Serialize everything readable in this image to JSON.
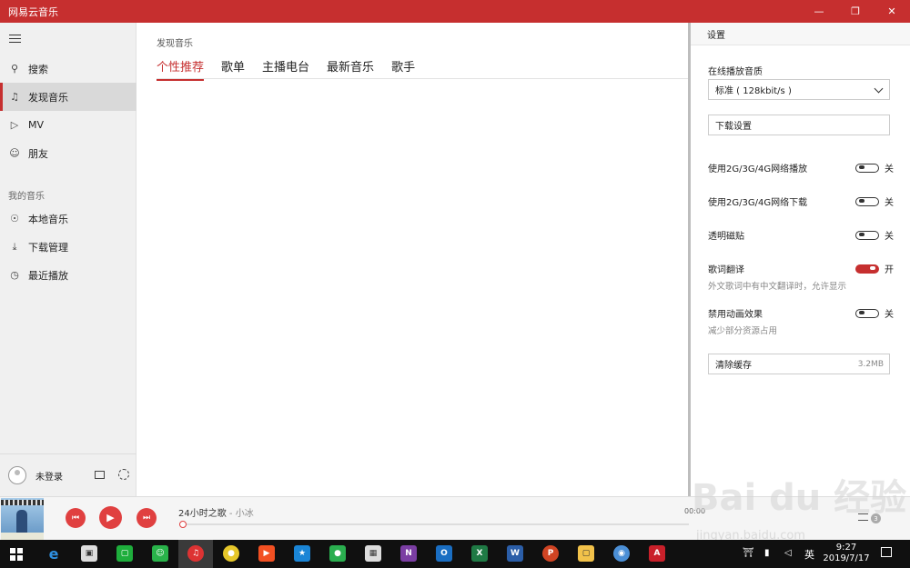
{
  "app": {
    "title": "网易云音乐"
  },
  "colors": {
    "accent": "#c62f2f",
    "sidebar": "#f0f0f0"
  },
  "sidebar": {
    "items": [
      {
        "label": "搜索",
        "icon": "search-icon"
      },
      {
        "label": "发现音乐",
        "icon": "music-note-icon",
        "active": true
      },
      {
        "label": "MV",
        "icon": "video-icon"
      },
      {
        "label": "朋友",
        "icon": "friends-icon"
      }
    ],
    "section_label": "我的音乐",
    "my_items": [
      {
        "label": "本地音乐",
        "icon": "disc-icon"
      },
      {
        "label": "下载管理",
        "icon": "download-icon"
      },
      {
        "label": "最近播放",
        "icon": "clock-icon"
      }
    ],
    "login_text": "未登录"
  },
  "main": {
    "page_title": "发现音乐",
    "tabs": [
      "个性推荐",
      "歌单",
      "主播电台",
      "最新音乐",
      "歌手"
    ]
  },
  "settings": {
    "header": "设置",
    "quality_label": "在线播放音质",
    "quality_value": "标准 ( 128kbit/s )",
    "download_settings": "下载设置",
    "toggles": [
      {
        "label": "使用2G/3G/4G网络播放",
        "state": "关",
        "on": false
      },
      {
        "label": "使用2G/3G/4G网络下载",
        "state": "关",
        "on": false
      },
      {
        "label": "透明磁贴",
        "state": "关",
        "on": false
      },
      {
        "label": "歌词翻译",
        "state": "开",
        "on": true,
        "sub": "外文歌词中有中文翻译时，允许显示"
      },
      {
        "label": "禁用动画效果",
        "state": "关",
        "on": false,
        "sub": "减少部分资源占用"
      }
    ],
    "clear_cache": "清除缓存",
    "cache_size": "3.2MB"
  },
  "player": {
    "song": "24小时之歌",
    "artist": "小冰",
    "separator": " - ",
    "time": "00:00",
    "playlist_count": "3"
  },
  "taskbar": {
    "time": "9:27",
    "date": "2019/7/17",
    "ime": "英"
  },
  "watermark": {
    "line1": "Bai du 经验",
    "line2": "jingyan.baidu.com"
  }
}
